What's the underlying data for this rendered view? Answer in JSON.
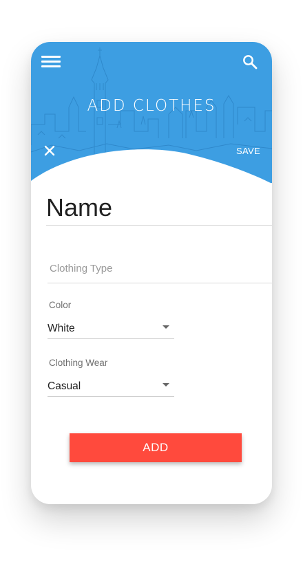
{
  "header": {
    "title": "ADD CLOTHES",
    "save_label": "SAVE",
    "menu_icon": "hamburger-menu-icon",
    "search_icon": "search-icon",
    "close_icon": "close-icon",
    "background_color": "#3d9ee2"
  },
  "form": {
    "name_value": "Name",
    "clothing_type_placeholder": "Clothing Type",
    "color": {
      "label": "Color",
      "value": "White"
    },
    "clothing_wear": {
      "label": "Clothing Wear",
      "value": "Casual"
    }
  },
  "add_button": {
    "label": "ADD",
    "color": "#ff4a3d"
  }
}
